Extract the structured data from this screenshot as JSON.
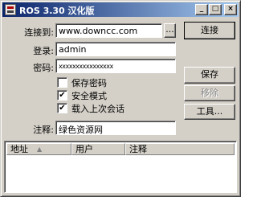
{
  "window": {
    "title": "ROS 3.30 汉化版",
    "minimize_glyph": "_",
    "maximize_glyph": "□",
    "close_glyph": "×"
  },
  "form": {
    "connect_to_label": "连接到:",
    "connect_to_value": "www.downcc.com",
    "browse_label": "...",
    "login_label": "登录:",
    "login_value": "admin",
    "password_label": "密码:",
    "password_value": "xxxxxxxxxxxxxxxx",
    "note_label": "注释:",
    "note_value": "绿色资源网"
  },
  "options": [
    {
      "label": "保存密码",
      "checked": false
    },
    {
      "label": "安全模式",
      "checked": true
    },
    {
      "label": "载入上次会话",
      "checked": true
    }
  ],
  "check_glyph": "✔",
  "buttons": {
    "connect": "连接",
    "save": "保存",
    "remove": "移除",
    "tools": "工具..."
  },
  "list": {
    "columns": [
      "地址",
      "用户",
      "注释"
    ],
    "sort_glyph": "▲",
    "rows": []
  }
}
